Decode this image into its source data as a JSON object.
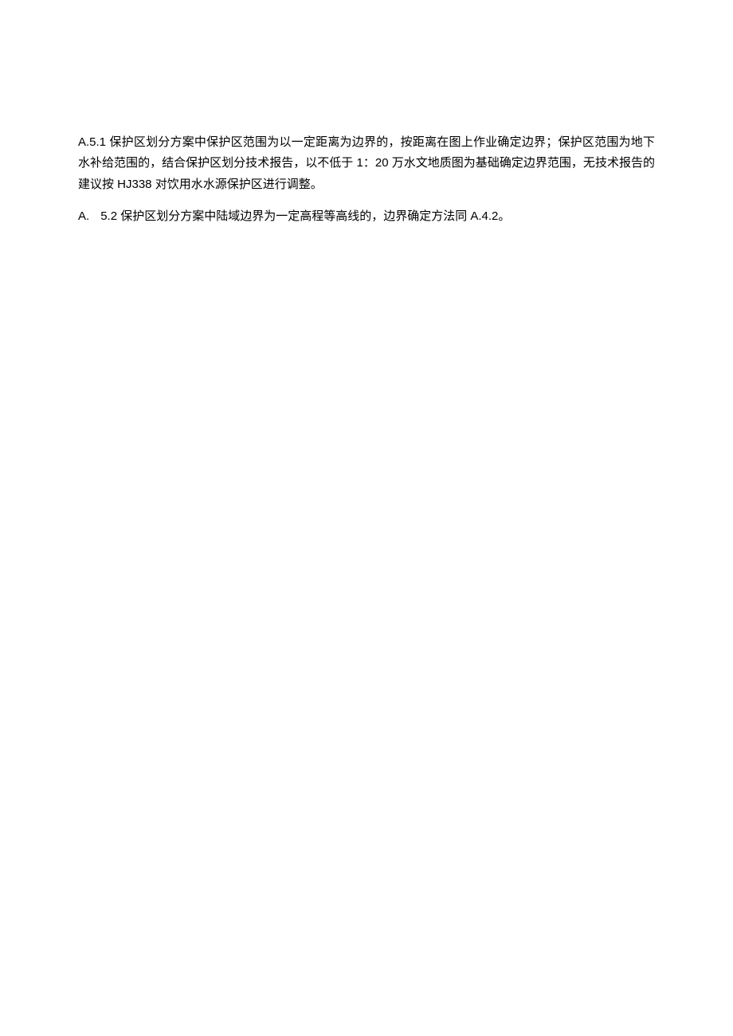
{
  "paragraphs": [
    {
      "type": "plain",
      "text": "A.5.1 保护区划分方案中保护区范围为以一定距离为边界的，按距离在图上作业确定边界；保护区范围为地下水补给范围的，结合保护区划分技术报告，以不低于 1：20 万水文地质图为基础确定边界范围，无技术报告的建议按 HJ338 对饮用水水源保护区进行调整。"
    },
    {
      "type": "list",
      "marker": "A.",
      "text": "5.2 保护区划分方案中陆域边界为一定高程等高线的，边界确定方法同 A.4.2。"
    }
  ]
}
